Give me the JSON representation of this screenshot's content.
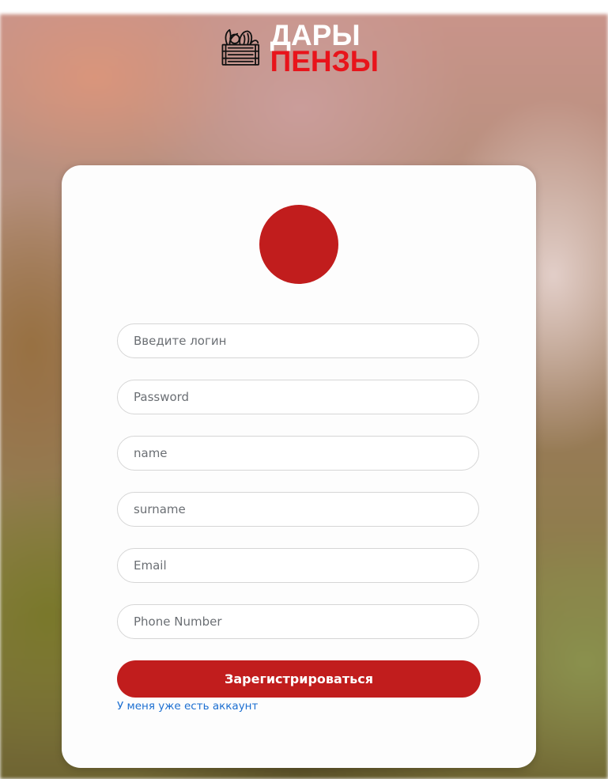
{
  "logo": {
    "line1": "ДАРЫ",
    "line2": "ПЕНЗЫ",
    "icon": "vegetable-crate-icon",
    "color_line1": "#ffffff",
    "color_line2": "#e8141b"
  },
  "form": {
    "avatar_color": "#c11d1d",
    "fields": {
      "login_placeholder": "Введите логин",
      "password_placeholder": "Password",
      "name_placeholder": "name",
      "surname_placeholder": "surname",
      "email_placeholder": "Email",
      "phone_placeholder": "Phone Number"
    },
    "submit_label": "Зарегистрироваться",
    "login_link_label": "У меня уже есть аккаунт",
    "accent_color": "#c11d1d",
    "link_color": "#1c6fd1"
  }
}
